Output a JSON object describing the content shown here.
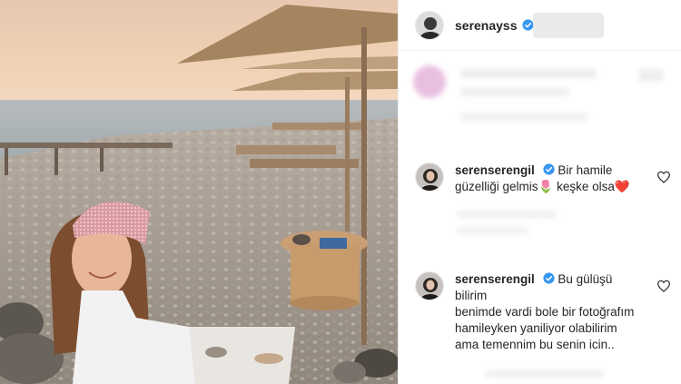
{
  "post": {
    "author_username": "serenayss"
  },
  "comments": [
    {
      "username": "serenserengil",
      "text_lines": [
        "Bir hamile",
        "güzelliği gelmis",
        "keşke olsa"
      ],
      "emoji_1": "🌷",
      "emoji_2": "❤️"
    },
    {
      "username": "serenserengil",
      "text_lines": [
        "Bu gülüşü bilirim",
        "benimde vardi bole bir fotoğrafım",
        "hamileyken yaniliyor olabilirim",
        "ama temennim bu senin icin.."
      ]
    }
  ],
  "colors": {
    "verified_blue": "#3897f0",
    "heart_red": "#ed4956",
    "username_text": "#262626"
  },
  "icons": {
    "verified": "verified-badge-icon",
    "like": "heart-outline-icon"
  }
}
